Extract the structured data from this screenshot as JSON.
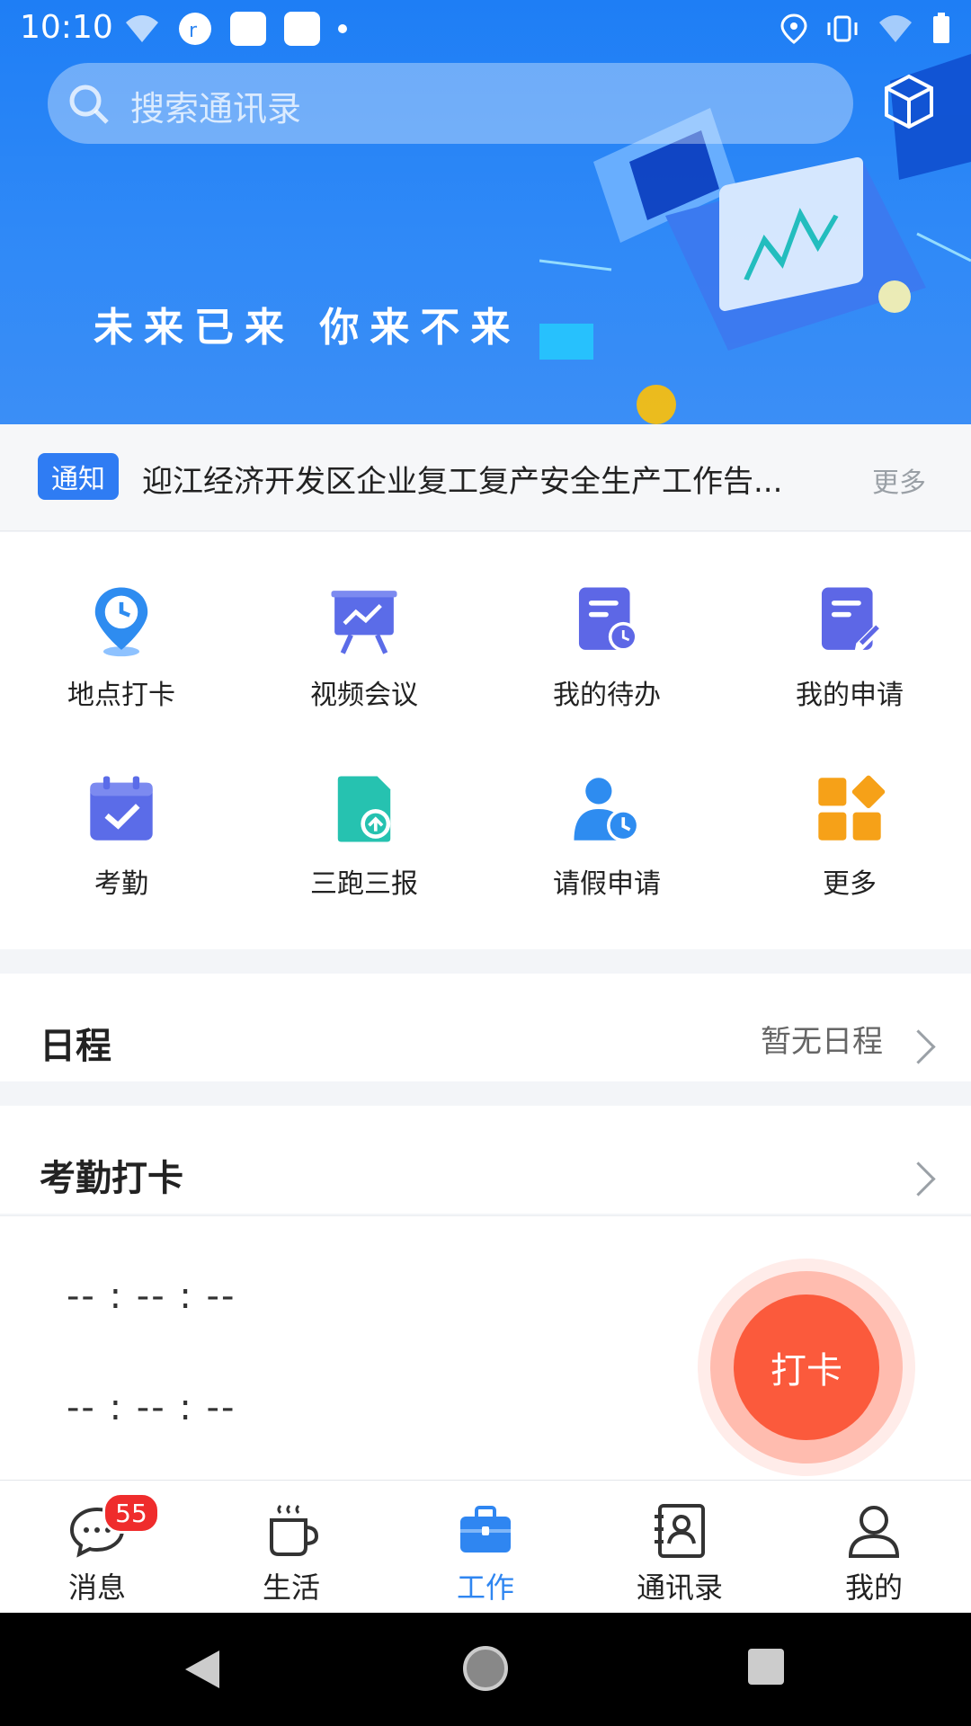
{
  "status_bar": {
    "time": "10:10"
  },
  "search": {
    "placeholder": "搜索通讯录"
  },
  "banner": {
    "slogan": "未来已来  你来不来"
  },
  "notice": {
    "badge": "通知",
    "text": "迎江经济开发区企业复工复产安全生产工作告...",
    "more": "更多"
  },
  "apps": [
    {
      "label": "地点打卡",
      "icon": "location-clock-icon",
      "color": "#2e8cf0"
    },
    {
      "label": "视频会议",
      "icon": "presentation-icon",
      "color": "#5b6ce8"
    },
    {
      "label": "我的待办",
      "icon": "todo-clock-icon",
      "color": "#5d67e6"
    },
    {
      "label": "我的申请",
      "icon": "edit-document-icon",
      "color": "#5d67e6"
    },
    {
      "label": "考勤",
      "icon": "calendar-check-icon",
      "color": "#5b6ce8"
    },
    {
      "label": "三跑三报",
      "icon": "upload-document-icon",
      "color": "#26c2b0"
    },
    {
      "label": "请假申请",
      "icon": "user-clock-icon",
      "color": "#2e8cf0"
    },
    {
      "label": "更多",
      "icon": "more-grid-icon",
      "color": "#f6a118"
    }
  ],
  "schedule": {
    "title": "日程",
    "status": "暂无日程"
  },
  "attendance": {
    "title": "考勤打卡",
    "time1": "-- : -- : --",
    "time2": "-- : -- : --",
    "punch_label": "打卡"
  },
  "tabs": [
    {
      "label": "消息",
      "badge": "55"
    },
    {
      "label": "生活"
    },
    {
      "label": "工作"
    },
    {
      "label": "通讯录"
    },
    {
      "label": "我的"
    }
  ],
  "colors": {
    "primary": "#2f86f1",
    "punch": "#fb5a3c",
    "badge": "#ef2c2c"
  }
}
